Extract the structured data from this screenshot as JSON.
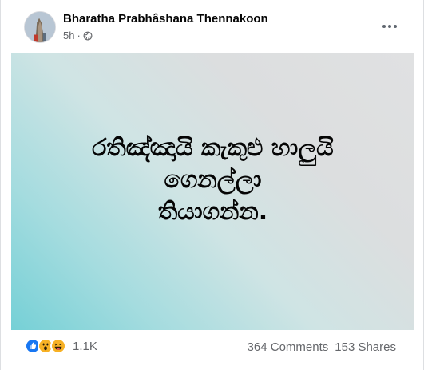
{
  "author": {
    "name": "Bharatha Prabhâshana Thennakoon",
    "timestamp": "5h",
    "audience_icon": "globe-icon"
  },
  "header": {
    "more_icon": "more-horizontal-icon"
  },
  "post": {
    "text": "රතිඤ්ඤායි කැකුළු හාලුයි\nගෙනල්ලා\nතියාගන්න.",
    "background_colors": [
      "#75d0d6",
      "#cfe4e4",
      "#e0e1e2"
    ]
  },
  "footer": {
    "reaction_icons": [
      "like-icon",
      "wow-icon",
      "haha-icon"
    ],
    "reaction_count": "1.1K",
    "comments": "364 Comments",
    "shares": "153 Shares"
  }
}
